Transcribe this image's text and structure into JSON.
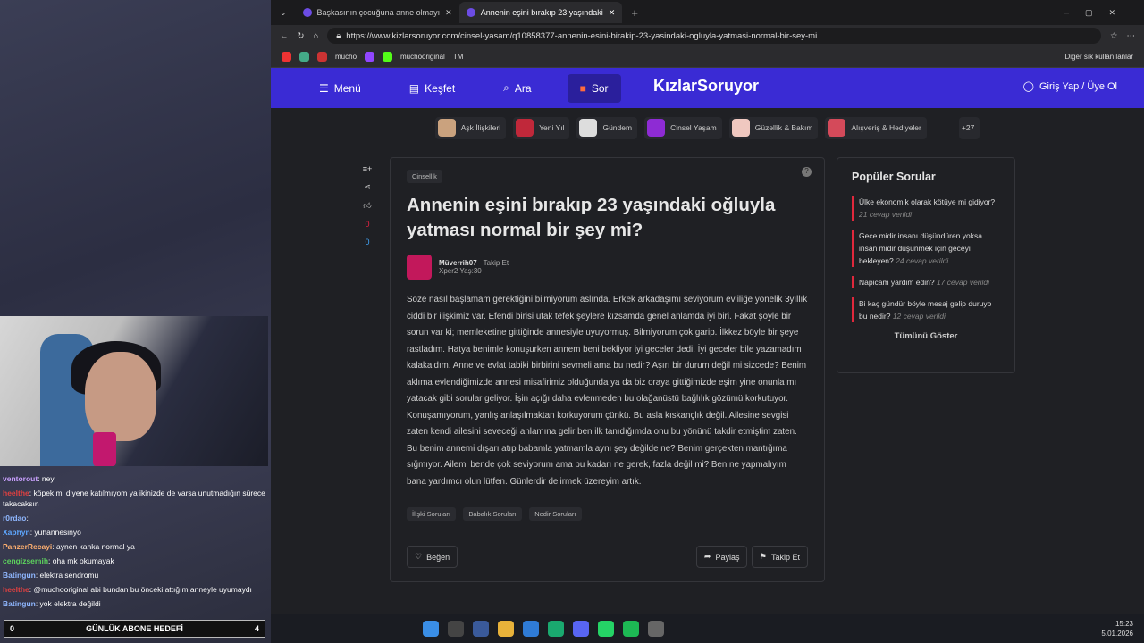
{
  "chat": [
    {
      "user": "ventorout",
      "color": "#c9a0ff",
      "text": ": ney"
    },
    {
      "user": "heelthe",
      "color": "#e04040",
      "text": ": köpek mi diyene katılmıyom ya ikinizde de varsa unutmadığın sürece takacaksın"
    },
    {
      "user": "r0rdao",
      "color": "#8fb7ff",
      "text": ":"
    },
    {
      "user": "Xaphyn",
      "color": "#5ea7ff",
      "text": ": yuhannesinyo"
    },
    {
      "user": "PanzerRecayi",
      "color": "#ffb070",
      "text": ": aynen kanka normal ya"
    },
    {
      "user": "cengizsemih",
      "color": "#5dd35d",
      "text": ": oha mk okumayak"
    },
    {
      "user": "Batingun",
      "color": "#8fb7ff",
      "text": ": elektra sendromu"
    },
    {
      "user": "heelthe",
      "color": "#e04040",
      "text": ": @muchooriginal abi bundan bu önceki attığım anneyle uyumaydı"
    },
    {
      "user": "Batingun",
      "color": "#8fb7ff",
      "text": ": yok elektra değildi"
    }
  ],
  "goal": {
    "left": "0",
    "title": "GÜNLÜK ABONE HEDEFİ",
    "right": "4"
  },
  "browser": {
    "tab1": "Başkasının çocuğuna anne olmayı",
    "tab2": "Annenin eşini bırakıp 23 yaşındaki",
    "url": "https://www.kizlarsoruyor.com/cinsel-yasam/q10858377-annenin-esini-birakip-23-yasindaki-ogluyla-yatmasi-normal-bir-sey-mi",
    "favorites": [
      "mucho",
      "muchooriginal",
      "TM"
    ],
    "other_favs": "Diğer sık kullanılanlar"
  },
  "nav": {
    "menu": "Menü",
    "kesfet": "Keşfet",
    "ara": "Ara",
    "sor": "Sor",
    "logo": "KızlarSoruyor",
    "login": "Giriş Yap / Üye Ol"
  },
  "categories": [
    {
      "label": "Aşk İlişkileri",
      "color": "#caa27e"
    },
    {
      "label": "Yeni Yıl",
      "color": "#c0283a"
    },
    {
      "label": "Gündem",
      "color": "#ddd"
    },
    {
      "label": "Cinsel Yaşam",
      "color": "#8e2bd4"
    },
    {
      "label": "Güzellik & Bakım",
      "color": "#f0c8c0"
    },
    {
      "label": "Alışveriş & Hediyeler",
      "color": "#d44a5a"
    }
  ],
  "cats_more": "+27",
  "vote_up": "0",
  "vote_down": "0",
  "question": {
    "category": "Cinsellik",
    "title": "Annenin eşini bırakıp 23 yaşındaki oğluyla yatması normal bir şey mi?",
    "author": "Müverrih07",
    "follow": "Takip Et",
    "meta": "Xper2 Yaş:30",
    "body": "Söze nasıl başlamam gerektiğini bilmiyorum aslında. Erkek arkadaşımı seviyorum evliliğe yönelik 3yıllık ciddi bir ilişkimiz var. Efendi birisi ufak tefek şeylere kızsamda genel anlamda iyi biri. Fakat şöyle bir sorun var ki; memleketine gittiğinde annesiyle uyuyormuş. Bilmiyorum çok garip. İlkkez böyle bir şeye rastladım. Hatya benimle konuşurken annem beni bekliyor iyi geceler dedi. İyi geceler bile yazamadım kalakaldım. Anne ve evlat tabiki birbirini sevmeli ama bu nedir? Aşırı bir durum değil mi sizcede? Benim aklıma evlendiğimizde annesi misafirimiz olduğunda ya da biz oraya gittiğimizde eşim yine onunla mı yatacak gibi sorular geliyor. İşin açığı daha evlenmeden bu olağanüstü bağlılık gözümü korkutuyor. Konuşamıyorum, yanlış anlaşılmaktan korkuyorum çünkü. Bu asla kıskançlık değil. Ailesine sevgisi zaten kendi ailesini seveceği anlamına gelir ben ilk tanıdığımda onu bu yönünü takdir etmiştim zaten. Bu benim annemi dışarı atıp babamla yatmamla aynı şey değilde ne? Benim gerçekten mantığıma sığmıyor. Ailemi bende çok seviyorum ama bu kadarı ne gerek, fazla değil mi? Ben ne yapmalıyım bana yardımcı olun lütfen. Günlerdir delirmek üzereyim artık.",
    "tags": [
      "İlişki Soruları",
      "Babalık Soruları",
      "Nedir Soruları"
    ],
    "like": "Beğen",
    "share": "Paylaş",
    "followbtn": "Takip Et"
  },
  "popular": {
    "title": "Popüler Sorular",
    "items": [
      {
        "q": "Ülke ekonomik olarak kötüye mi gidiyor?",
        "c": "21 cevap verildi"
      },
      {
        "q": "Gece midir insanı düşündüren yoksa insan midir düşünmek için geceyi bekleyen?",
        "c": "24 cevap verildi"
      },
      {
        "q": "Napicam yardim edin?",
        "c": "17 cevap verildi"
      },
      {
        "q": "Bi kaç gündür böyle mesaj gelip duruyo bu nedir?",
        "c": "12 cevap verildi"
      }
    ],
    "show_all": "Tümünü Göster"
  },
  "clock": {
    "time": "15:23",
    "date": "5.01.2026"
  }
}
